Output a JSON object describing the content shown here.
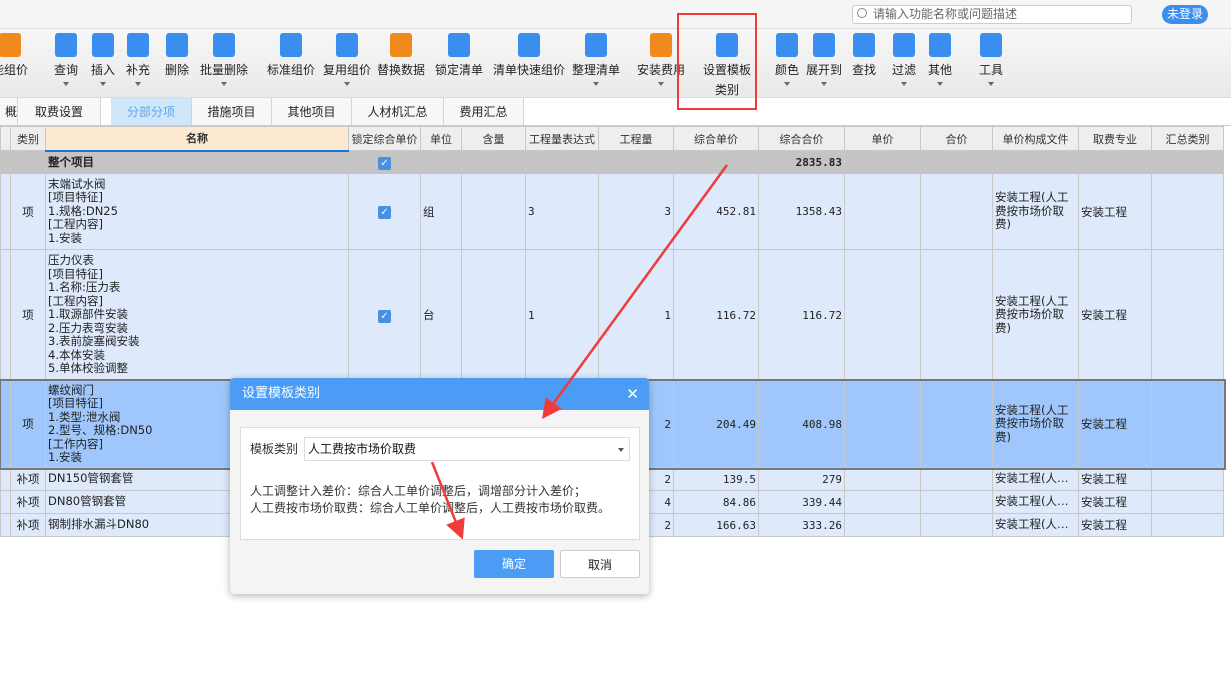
{
  "header": {
    "search_placeholder": "请输入功能名称或问题描述",
    "login_label": "未登录"
  },
  "toolbar": [
    {
      "label": "能组价",
      "icon": "smart-price-icon",
      "color": "#f08a1c"
    },
    {
      "label": "查询",
      "icon": "query-icon",
      "color": "#3a8ef0",
      "dropdown": true
    },
    {
      "label": "插入",
      "icon": "insert-icon",
      "color": "#3a8ef0",
      "dropdown": true
    },
    {
      "label": "补充",
      "icon": "supplement-icon",
      "color": "#3a8ef0",
      "dropdown": true
    },
    {
      "label": "删除",
      "icon": "trash-icon",
      "color": "#3a8ef0"
    },
    {
      "label": "批量删除",
      "icon": "batch-delete-icon",
      "color": "#3a8ef0",
      "dropdown": true
    },
    {
      "label": "标准组价",
      "icon": "standard-price-icon",
      "color": "#3a8ef0"
    },
    {
      "label": "复用组价",
      "icon": "reuse-price-icon",
      "color": "#3a8ef0",
      "dropdown": true
    },
    {
      "label": "替换数据",
      "icon": "replace-data-icon",
      "color": "#f08a1c"
    },
    {
      "label": "锁定清单",
      "icon": "lock-icon",
      "color": "#3a8ef0"
    },
    {
      "label": "清单快速组价",
      "icon": "quick-price-icon",
      "color": "#3a8ef0"
    },
    {
      "label": "整理清单",
      "icon": "organize-list-icon",
      "color": "#3a8ef0",
      "dropdown": true
    },
    {
      "label": "安装费用",
      "icon": "install-fee-icon",
      "color": "#f08a1c",
      "dropdown": true
    },
    {
      "label": "设置模板",
      "label2": "类别",
      "icon": "template-category-icon",
      "color": "#3a8ef0"
    },
    {
      "label": "颜色",
      "icon": "paint-bucket-icon",
      "color": "#3a8ef0",
      "dropdown": true
    },
    {
      "label": "展开到",
      "icon": "expand-tree-icon",
      "color": "#3a8ef0",
      "dropdown": true
    },
    {
      "label": "查找",
      "icon": "binoculars-icon",
      "color": "#3a8ef0"
    },
    {
      "label": "过滤",
      "icon": "filter-icon",
      "color": "#3a8ef0",
      "dropdown": true
    },
    {
      "label": "其他",
      "icon": "grid-apps-icon",
      "color": "#3a8ef0",
      "dropdown": true
    },
    {
      "label": "工具",
      "icon": "tools-icon",
      "color": "#3a8ef0",
      "dropdown": true
    }
  ],
  "tabs": [
    {
      "label": "概况"
    },
    {
      "label": "取费设置"
    },
    {
      "label": "分部分项",
      "active": true
    },
    {
      "label": "措施项目"
    },
    {
      "label": "其他项目"
    },
    {
      "label": "人材机汇总"
    },
    {
      "label": "费用汇总"
    }
  ],
  "table": {
    "columns": [
      "类别",
      "名称",
      "锁定综合单价",
      "单位",
      "含量",
      "工程量表达式",
      "工程量",
      "综合单价",
      "综合合价",
      "单价",
      "合价",
      "单价构成文件",
      "取费专业",
      "汇总类别"
    ],
    "total": {
      "name": "整个项目",
      "locked": true,
      "amount": "2835.83"
    },
    "rows": [
      {
        "type": "项",
        "name": [
          "末端试水阀",
          "[项目特征]",
          "1.规格:DN25",
          "[工程内容]",
          "1.安装"
        ],
        "locked": true,
        "unit": "组",
        "expr": "3",
        "qty": "3",
        "unit_price": "452.81",
        "total": "1358.43",
        "file": "安装工程(人工费按市场价取费)",
        "spec": "安装工程"
      },
      {
        "type": "项",
        "name": [
          "压力仪表",
          "[项目特征]",
          "1.名称:压力表",
          "[工程内容]",
          "1.取源部件安装",
          "2.压力表弯安装",
          "3.表前旋塞阀安装",
          "4.本体安装",
          "5.单体校验调整"
        ],
        "locked": true,
        "unit": "台",
        "expr": "1",
        "qty": "1",
        "unit_price": "116.72",
        "total": "116.72",
        "file": "安装工程(人工费按市场价取费)",
        "spec": "安装工程"
      },
      {
        "type": "项",
        "name": [
          "螺纹阀门",
          "[项目特征]",
          "1.类型:泄水阀",
          "2.型号、规格:DN50",
          "[工作内容]",
          "1.安装"
        ],
        "selected": true,
        "qty": "2",
        "unit_price": "204.49",
        "total": "408.98",
        "file": "安装工程(人工费按市场价取费)",
        "spec": "安装工程"
      },
      {
        "type": "补项",
        "name": [
          "DN150管钢套管"
        ],
        "qty": "2",
        "unit_price": "139.5",
        "total": "279",
        "file": "安装工程(人…",
        "spec": "安装工程"
      },
      {
        "type": "补项",
        "name": [
          "DN80管钢套管"
        ],
        "qty": "4",
        "unit_price": "84.86",
        "total": "339.44",
        "file": "安装工程(人…",
        "spec": "安装工程"
      },
      {
        "type": "补项",
        "name": [
          "钢制排水漏斗DN80"
        ],
        "qty": "2",
        "unit_price": "166.63",
        "total": "333.26",
        "file": "安装工程(人…",
        "spec": "安装工程"
      }
    ]
  },
  "dialog": {
    "title": "设置模板类别",
    "field_label": "模板类别",
    "selected_value": "人工费按市场价取费",
    "desc_line1": "人工调整计入差价：综合人工单价调整后，调增部分计入差价；",
    "desc_line2": "人工费按市场价取费：综合人工单价调整后，人工费按市场价取费。",
    "ok_label": "确定",
    "cancel_label": "取消"
  },
  "colors": {
    "accent": "#4a9cf5",
    "annotation": "#f03b3b",
    "selected_row": "#9fc7fb",
    "row": "#deeafb"
  }
}
